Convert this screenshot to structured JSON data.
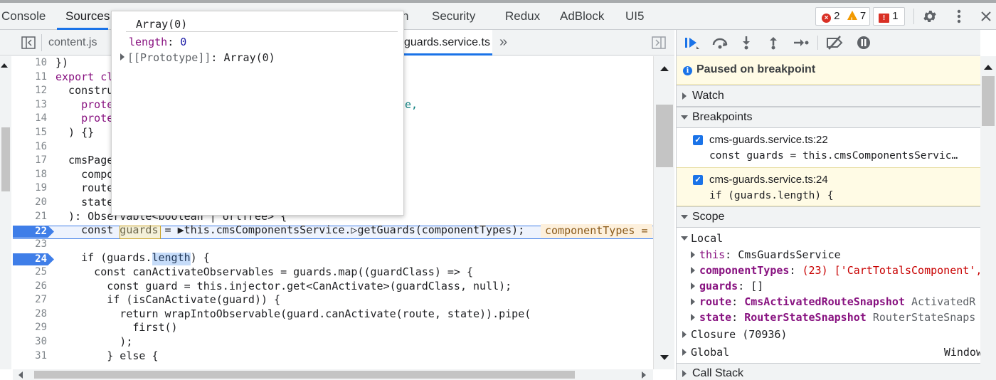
{
  "tabs": [
    {
      "label": "Console"
    },
    {
      "label": "Sources"
    },
    {
      "label": "n"
    },
    {
      "label": "Security"
    },
    {
      "label": "Redux"
    },
    {
      "label": "AdBlock"
    },
    {
      "label": "UI5"
    }
  ],
  "counters": {
    "errors": "2",
    "warnings": "7",
    "issues": "1"
  },
  "files": {
    "first": "content.js",
    "active": "guards.service.ts",
    "close": "×",
    "more": "»"
  },
  "popup": {
    "title": "Array(0)",
    "length_key": "length",
    "length_val": "0",
    "proto_key": "[[Prototype]]",
    "proto_val": "Array(0)"
  },
  "code": {
    "lines": [
      {
        "n": "10",
        "t": "})"
      },
      {
        "n": "11",
        "t": "export cl"
      },
      {
        "n": "12",
        "t": "  constru"
      },
      {
        "n": "13",
        "t": "    prote",
        "tail": "ce,"
      },
      {
        "n": "14",
        "t": "    prote"
      },
      {
        "n": "15",
        "t": "  ) {}"
      },
      {
        "n": "16",
        "t": ""
      },
      {
        "n": "17",
        "t": "  cmsPage"
      },
      {
        "n": "18",
        "t": "    compo"
      },
      {
        "n": "19",
        "t": "    route"
      },
      {
        "n": "20",
        "t": "    state"
      },
      {
        "n": "21",
        "t": "  ): Observable<boolean | UrlTree> {"
      },
      {
        "n": "22",
        "t": "    const guards = ▶this.cmsComponentsService.▷getGuards(componentTypes);"
      },
      {
        "n": "23",
        "t": ""
      },
      {
        "n": "24",
        "t": "    if (guards.length) {"
      },
      {
        "n": "25",
        "t": "      const canActivateObservables = guards.map((guardClass) => {"
      },
      {
        "n": "26",
        "t": "        const guard = this.injector.get<CanActivate>(guardClass, null);"
      },
      {
        "n": "27",
        "t": "        if (isCanActivate(guard)) {"
      },
      {
        "n": "28",
        "t": "          return wrapIntoObservable(guard.canActivate(route, state)).pipe("
      },
      {
        "n": "29",
        "t": "            first()"
      },
      {
        "n": "30",
        "t": "          );"
      },
      {
        "n": "31",
        "t": "        } else {"
      }
    ],
    "inline_value": "componentTypes ="
  },
  "debugger": {
    "paused_text": "Paused on breakpoint",
    "watch": "Watch",
    "breakpoints_title": "Breakpoints",
    "breakpoints": [
      {
        "file": "cms-guards.service.ts:22",
        "code": "const guards = this.cmsComponentsServic…"
      },
      {
        "file": "cms-guards.service.ts:24",
        "code": "if (guards.length) {"
      }
    ],
    "scope_title": "Scope",
    "local": "Local",
    "scope_vars": [
      {
        "key": "this",
        "val": "CmsGuardsService"
      },
      {
        "key": "componentTypes",
        "val": "(23) ['CartTotalsComponent',"
      },
      {
        "key": "guards",
        "val": "[]"
      },
      {
        "key": "route",
        "val": "CmsActivatedRouteSnapshot",
        "type": "ActivatedR"
      },
      {
        "key": "state",
        "val": "RouterStateSnapshot",
        "type": "RouterStateSnaps"
      }
    ],
    "closure": "Closure (70936)",
    "global": "Global",
    "global_val": "Window",
    "call_stack": "Call Stack"
  },
  "colors": {
    "accent": "#1a73e8",
    "paused_bg": "#fffbe5",
    "bp_blue": "#3f7ee8",
    "keyword": "#881280"
  }
}
